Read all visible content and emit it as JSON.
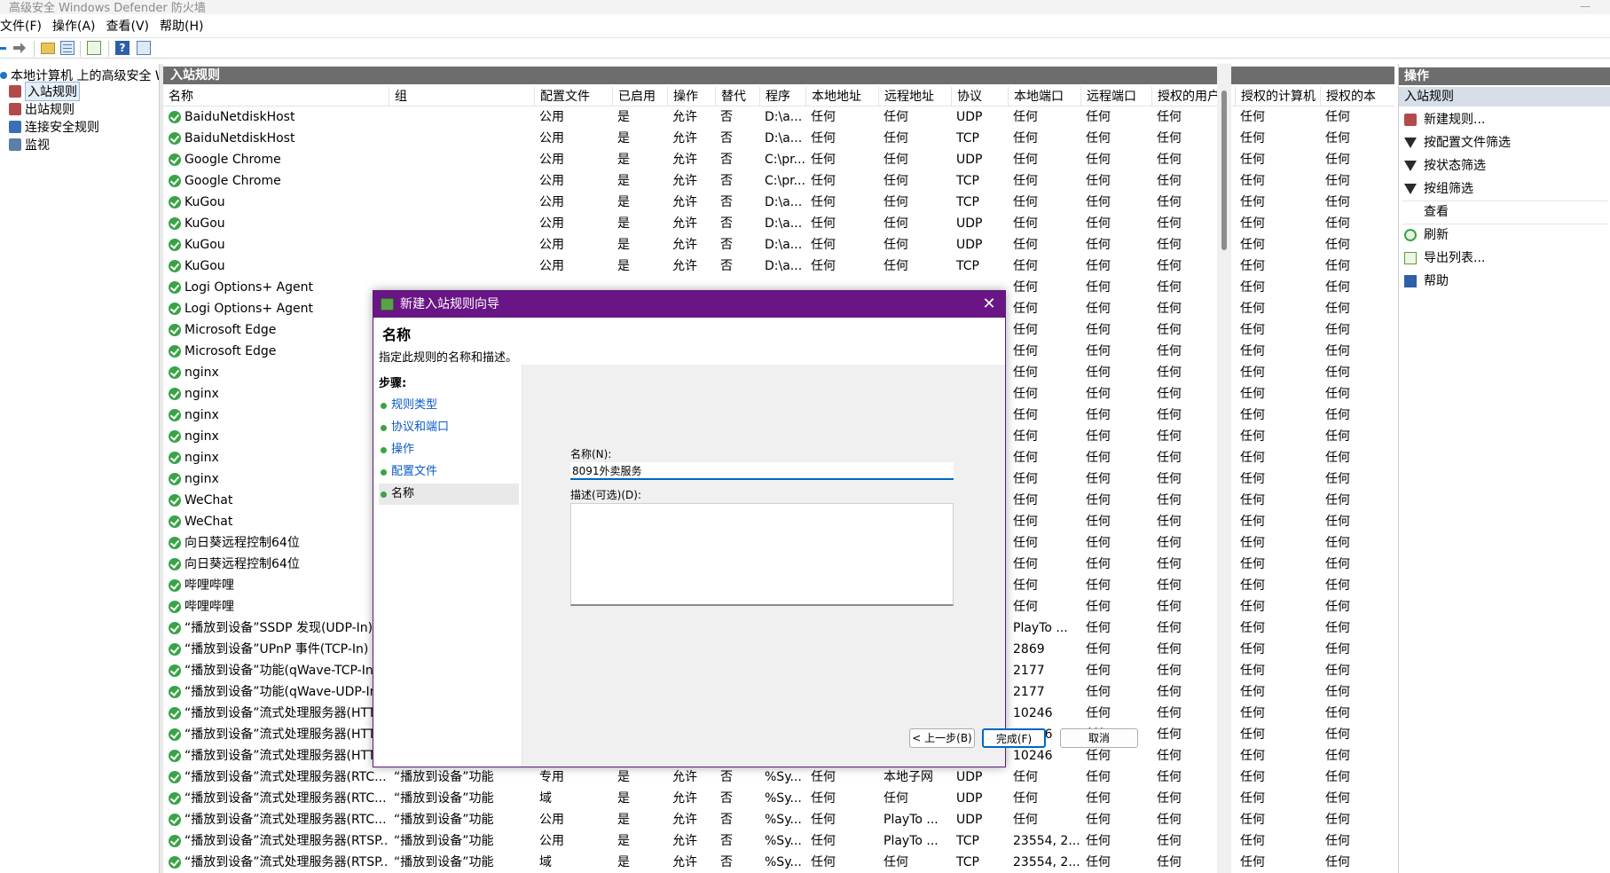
{
  "window": {
    "title": "高级安全 Windows Defender 防火墙",
    "minimize": "—"
  },
  "menu": [
    "文件(F)",
    "操作(A)",
    "查看(V)",
    "帮助(H)"
  ],
  "tree": [
    {
      "label": "本地计算机 上的高级安全 W",
      "color": "#1e73c7"
    },
    {
      "label": "入站规则",
      "color": "#b24a4a"
    },
    {
      "label": "出站规则",
      "color": "#b24a4a"
    },
    {
      "label": "连接安全规则",
      "color": "#3a6fb5"
    },
    {
      "label": "监视",
      "color": "#5a7fa8"
    }
  ],
  "main": {
    "header": "入站规则",
    "columns": [
      "名称",
      "组",
      "配置文件",
      "已启用",
      "操作",
      "替代",
      "程序",
      "本地地址",
      "远程地址",
      "协议",
      "本地端口",
      "远程端口",
      "授权的用户",
      "授权的计算机",
      "授权的本"
    ],
    "rows": [
      [
        "BaiduNetdiskHost",
        "",
        "公用",
        "是",
        "允许",
        "否",
        "D:\\a...",
        "任何",
        "任何",
        "UDP",
        "任何",
        "任何",
        "任何",
        "任何",
        "任何"
      ],
      [
        "BaiduNetdiskHost",
        "",
        "公用",
        "是",
        "允许",
        "否",
        "D:\\a...",
        "任何",
        "任何",
        "TCP",
        "任何",
        "任何",
        "任何",
        "任何",
        "任何"
      ],
      [
        "Google Chrome",
        "",
        "公用",
        "是",
        "允许",
        "否",
        "C:\\pr...",
        "任何",
        "任何",
        "UDP",
        "任何",
        "任何",
        "任何",
        "任何",
        "任何"
      ],
      [
        "Google Chrome",
        "",
        "公用",
        "是",
        "允许",
        "否",
        "C:\\pr...",
        "任何",
        "任何",
        "TCP",
        "任何",
        "任何",
        "任何",
        "任何",
        "任何"
      ],
      [
        "KuGou",
        "",
        "公用",
        "是",
        "允许",
        "否",
        "D:\\a...",
        "任何",
        "任何",
        "TCP",
        "任何",
        "任何",
        "任何",
        "任何",
        "任何"
      ],
      [
        "KuGou",
        "",
        "公用",
        "是",
        "允许",
        "否",
        "D:\\a...",
        "任何",
        "任何",
        "UDP",
        "任何",
        "任何",
        "任何",
        "任何",
        "任何"
      ],
      [
        "KuGou",
        "",
        "公用",
        "是",
        "允许",
        "否",
        "D:\\a...",
        "任何",
        "任何",
        "UDP",
        "任何",
        "任何",
        "任何",
        "任何",
        "任何"
      ],
      [
        "KuGou",
        "",
        "公用",
        "是",
        "允许",
        "否",
        "D:\\a...",
        "任何",
        "任何",
        "TCP",
        "任何",
        "任何",
        "任何",
        "任何",
        "任何"
      ],
      [
        "Logi Options+ Agent",
        "",
        "",
        "",
        "",
        "",
        "",
        "",
        "",
        "",
        "任何",
        "任何",
        "任何",
        "任何",
        "任何"
      ],
      [
        "Logi Options+ Agent",
        "",
        "",
        "",
        "",
        "",
        "",
        "",
        "",
        "",
        "任何",
        "任何",
        "任何",
        "任何",
        "任何"
      ],
      [
        "Microsoft Edge",
        "",
        "",
        "",
        "",
        "",
        "",
        "",
        "",
        "",
        "任何",
        "任何",
        "任何",
        "任何",
        "任何"
      ],
      [
        "Microsoft Edge",
        "",
        "",
        "",
        "",
        "",
        "",
        "",
        "",
        "",
        "任何",
        "任何",
        "任何",
        "任何",
        "任何"
      ],
      [
        "nginx",
        "",
        "",
        "",
        "",
        "",
        "",
        "",
        "",
        "",
        "任何",
        "任何",
        "任何",
        "任何",
        "任何"
      ],
      [
        "nginx",
        "",
        "",
        "",
        "",
        "",
        "",
        "",
        "",
        "",
        "任何",
        "任何",
        "任何",
        "任何",
        "任何"
      ],
      [
        "nginx",
        "",
        "",
        "",
        "",
        "",
        "",
        "",
        "",
        "",
        "任何",
        "任何",
        "任何",
        "任何",
        "任何"
      ],
      [
        "nginx",
        "",
        "",
        "",
        "",
        "",
        "",
        "",
        "",
        "",
        "任何",
        "任何",
        "任何",
        "任何",
        "任何"
      ],
      [
        "nginx",
        "",
        "",
        "",
        "",
        "",
        "",
        "",
        "",
        "",
        "任何",
        "任何",
        "任何",
        "任何",
        "任何"
      ],
      [
        "nginx",
        "",
        "",
        "",
        "",
        "",
        "",
        "",
        "",
        "",
        "任何",
        "任何",
        "任何",
        "任何",
        "任何"
      ],
      [
        "WeChat",
        "",
        "",
        "",
        "",
        "",
        "",
        "",
        "",
        "",
        "任何",
        "任何",
        "任何",
        "任何",
        "任何"
      ],
      [
        "WeChat",
        "",
        "",
        "",
        "",
        "",
        "",
        "",
        "",
        "",
        "任何",
        "任何",
        "任何",
        "任何",
        "任何"
      ],
      [
        "向日葵远程控制64位",
        "",
        "",
        "",
        "",
        "",
        "",
        "",
        "",
        "",
        "任何",
        "任何",
        "任何",
        "任何",
        "任何"
      ],
      [
        "向日葵远程控制64位",
        "",
        "",
        "",
        "",
        "",
        "",
        "",
        "",
        "",
        "任何",
        "任何",
        "任何",
        "任何",
        "任何"
      ],
      [
        "哔哩哔哩",
        "",
        "",
        "",
        "",
        "",
        "",
        "",
        "",
        "",
        "任何",
        "任何",
        "任何",
        "任何",
        "任何"
      ],
      [
        "哔哩哔哩",
        "",
        "",
        "",
        "",
        "",
        "",
        "",
        "",
        "",
        "任何",
        "任何",
        "任何",
        "任何",
        "任何"
      ],
      [
        "“播放到设备”SSDP 发现(UDP-In)",
        "",
        "",
        "",
        "",
        "",
        "",
        "",
        "",
        "",
        "PlayTo ...",
        "任何",
        "任何",
        "任何",
        "任何"
      ],
      [
        "“播放到设备”UPnP 事件(TCP-In)",
        "",
        "",
        "",
        "",
        "",
        "",
        "",
        "",
        "",
        "2869",
        "任何",
        "任何",
        "任何",
        "任何"
      ],
      [
        "“播放到设备”功能(qWave-TCP-In)",
        "",
        "",
        "",
        "",
        "",
        "",
        "",
        "",
        "",
        "2177",
        "任何",
        "任何",
        "任何",
        "任何"
      ],
      [
        "“播放到设备”功能(qWave-UDP-In)",
        "",
        "",
        "",
        "",
        "",
        "",
        "",
        "",
        "",
        "2177",
        "任何",
        "任何",
        "任何",
        "任何"
      ],
      [
        "“播放到设备”流式处理服务器(HTT...",
        "",
        "",
        "",
        "",
        "",
        "",
        "",
        "",
        "",
        "10246",
        "任何",
        "任何",
        "任何",
        "任何"
      ],
      [
        "“播放到设备”流式处理服务器(HTT...",
        "",
        "",
        "",
        "",
        "",
        "",
        "",
        "",
        "",
        "10246",
        "任何",
        "任何",
        "任何",
        "任何"
      ],
      [
        "“播放到设备”流式处理服务器(HTT...",
        "",
        "",
        "",
        "",
        "",
        "",
        "",
        "",
        "",
        "10246",
        "任何",
        "任何",
        "任何",
        "任何"
      ],
      [
        "“播放到设备”流式处理服务器(RTC...",
        "“播放到设备”功能",
        "专用",
        "是",
        "允许",
        "否",
        "%Sy...",
        "任何",
        "本地子网",
        "UDP",
        "任何",
        "任何",
        "任何",
        "任何",
        "任何"
      ],
      [
        "“播放到设备”流式处理服务器(RTC...",
        "“播放到设备”功能",
        "域",
        "是",
        "允许",
        "否",
        "%Sy...",
        "任何",
        "任何",
        "UDP",
        "任何",
        "任何",
        "任何",
        "任何",
        "任何"
      ],
      [
        "“播放到设备”流式处理服务器(RTC...",
        "“播放到设备”功能",
        "公用",
        "是",
        "允许",
        "否",
        "%Sy...",
        "任何",
        "PlayTo ...",
        "UDP",
        "任何",
        "任何",
        "任何",
        "任何",
        "任何"
      ],
      [
        "“播放到设备”流式处理服务器(RTSP...",
        "“播放到设备”功能",
        "公用",
        "是",
        "允许",
        "否",
        "%Sy...",
        "任何",
        "PlayTo ...",
        "TCP",
        "23554, 2...",
        "任何",
        "任何",
        "任何",
        "任何"
      ],
      [
        "“播放到设备”流式处理服务器(RTSP...",
        "“播放到设备”功能",
        "域",
        "是",
        "允许",
        "否",
        "%Sy...",
        "任何",
        "任何",
        "TCP",
        "23554, 2...",
        "任何",
        "任何",
        "任何",
        "任何"
      ]
    ]
  },
  "actions": {
    "header": "操作",
    "section": "入站规则",
    "items": [
      {
        "label": "新建规则...",
        "icon": "new-rule-icon"
      },
      {
        "label": "按配置文件筛选",
        "icon": "filter-icon"
      },
      {
        "label": "按状态筛选",
        "icon": "filter-icon"
      },
      {
        "label": "按组筛选",
        "icon": "filter-icon"
      },
      {
        "label": "查看",
        "icon": "view-icon"
      },
      {
        "label": "刷新",
        "icon": "refresh-icon"
      },
      {
        "label": "导出列表...",
        "icon": "export-icon"
      },
      {
        "label": "帮助",
        "icon": "help-icon"
      }
    ]
  },
  "dialog": {
    "title": "新建入站规则向导",
    "close": "✕",
    "heading": "名称",
    "subheading": "指定此规则的名称和描述。",
    "steps_label": "步骤:",
    "steps": [
      "规则类型",
      "协议和端口",
      "操作",
      "配置文件",
      "名称"
    ],
    "name_label": "名称(N):",
    "name_value": "8091外卖服务",
    "desc_label": "描述(可选)(D):",
    "desc_value": "",
    "back_button": "< 上一步(B)",
    "finish_button": "完成(F)",
    "cancel_button": "取消"
  },
  "colors": {
    "title_bar": "#6a1585",
    "accent": "#0067c0",
    "rule_enabled": "#3aa347",
    "pane_header": "#6d6d6d"
  }
}
